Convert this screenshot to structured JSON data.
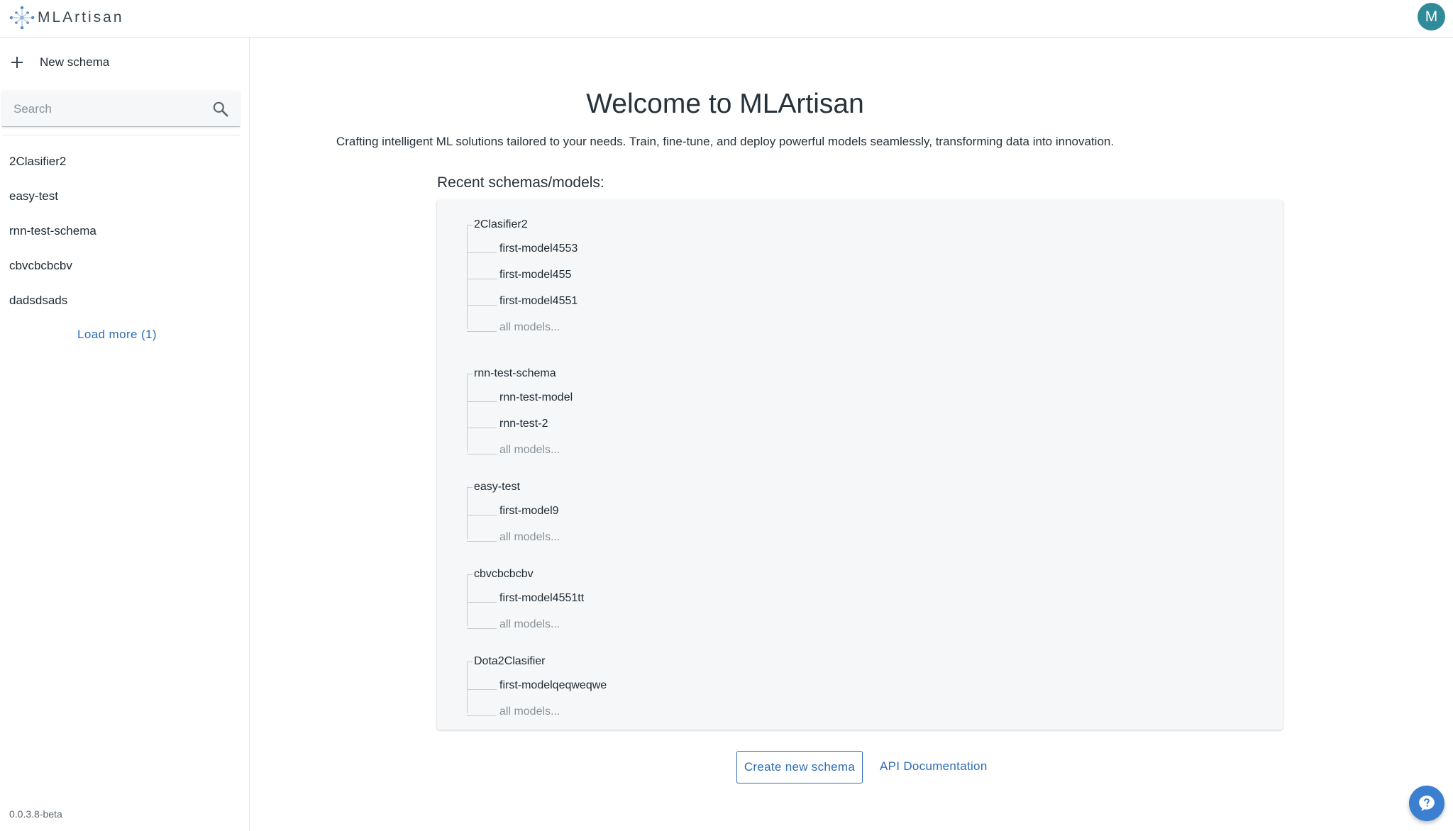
{
  "header": {
    "logo_text": "MLArtisan",
    "avatar_initial": "M",
    "accent_color": "#2f8a99"
  },
  "sidebar": {
    "new_schema_label": "New schema",
    "search_placeholder": "Search",
    "items": [
      {
        "label": "2Clasifier2"
      },
      {
        "label": "easy-test"
      },
      {
        "label": "rnn-test-schema"
      },
      {
        "label": "cbvcbcbcbv"
      },
      {
        "label": "dadsdsads"
      }
    ],
    "load_more_label": "Load more (1)",
    "version": "0.0.3.8-beta"
  },
  "main": {
    "title": "Welcome to MLArtisan",
    "subtitle": "Crafting intelligent ML solutions tailored to your needs. Train, fine-tune, and deploy powerful models seamlessly, transforming data into innovation.",
    "recent_heading": "Recent schemas/models:",
    "tree": [
      {
        "schema": "2Clasifier2",
        "models": [
          "first-model4553",
          "first-model455",
          "first-model4551"
        ],
        "all_label": "all models..."
      },
      {
        "schema": "rnn-test-schema",
        "models": [
          "rnn-test-model",
          "rnn-test-2"
        ],
        "all_label": "all models..."
      },
      {
        "schema": "easy-test",
        "models": [
          "first-model9"
        ],
        "all_label": "all models..."
      },
      {
        "schema": "cbvcbcbcbv",
        "models": [
          "first-model4551tt"
        ],
        "all_label": "all models..."
      },
      {
        "schema": "Dota2Clasifier",
        "models": [
          "first-modelqeqweqwe"
        ],
        "all_label": "all models..."
      }
    ],
    "create_button_label": "Create new schema",
    "api_link_label": "API Documentation"
  },
  "help": {
    "icon": "help-icon",
    "color": "#3a7fd0"
  }
}
